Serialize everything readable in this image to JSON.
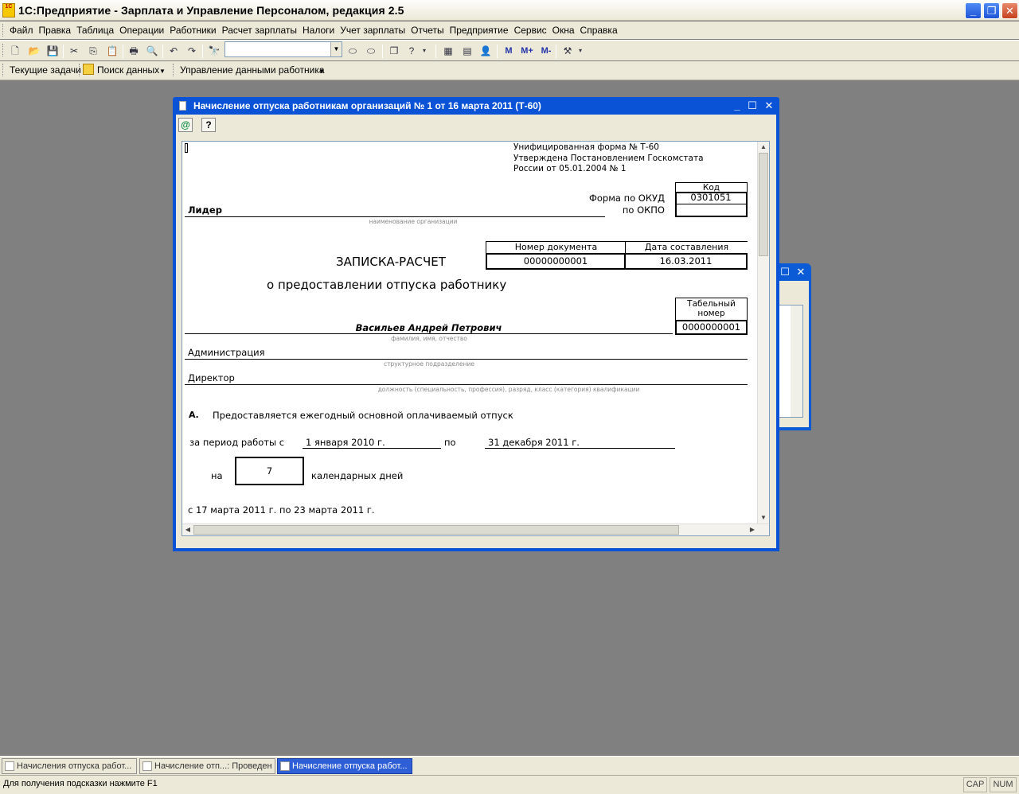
{
  "app": {
    "title": "1С:Предприятие - Зарплата и Управление Персоналом, редакция 2.5",
    "logo_text": "1С"
  },
  "menu": [
    "Файл",
    "Правка",
    "Таблица",
    "Операции",
    "Работники",
    "Расчет зарплаты",
    "Налоги",
    "Учет зарплаты",
    "Отчеты",
    "Предприятие",
    "Сервис",
    "Окна",
    "Справка"
  ],
  "toolbar": {
    "search_value": "",
    "m_labels": [
      "M",
      "M+",
      "M-"
    ]
  },
  "toolbar2": {
    "current_tasks": "Текущие задачи",
    "data_search": "Поиск данных",
    "employee_data": "Управление данными работника"
  },
  "doc_window": {
    "title": "Начисление отпуска работникам организаций № 1 от 16 марта 2011 (Т-60)"
  },
  "form": {
    "header_line1": "Унифицированная форма № Т-60",
    "header_line2": "Утверждена Постановлением Госкомстата",
    "header_line3": "России от 05.01.2004 № 1",
    "code_label": "Код",
    "okud_label": "Форма по ОКУД",
    "okud_value": "0301051",
    "okpo_label": "по ОКПО",
    "okpo_value": "",
    "org_name": "Лидер",
    "org_caption": "наименование организации",
    "doc_number_label": "Номер документа",
    "doc_date_label": "Дата составления",
    "doc_number": "00000000001",
    "doc_date": "16.03.2011",
    "title": "ЗАПИСКА-РАСЧЕТ",
    "subtitle": "о предоставлении отпуска работнику",
    "tab_number_label": "Табельный номер",
    "tab_number": "0000000001",
    "employee_name": "Васильев Андрей Петрович",
    "employee_caption": "фамилия, имя, отчество",
    "department": "Администрация",
    "department_caption": "структурное подразделение",
    "position": "Директор",
    "position_caption": "должность (специальность, профессия), разряд, класс (категория) квалификации",
    "section_letter": "А.",
    "section_text": "Предоставляется ежегодный основной оплачиваемый отпуск",
    "period_label": "за период работы с",
    "period_from": "1 января 2010 г.",
    "period_to_label": "по",
    "period_to": "31 декабря 2011 г.",
    "days_label_pre": "на",
    "days_value": "7",
    "days_label_post": "календарных дней",
    "dates_range": "с 17 марта 2011 г.   по 23 марта 2011 г."
  },
  "taskbar": [
    {
      "label": "Начисления отпуска работ...",
      "active": false
    },
    {
      "label": "Начисление отп...: Проведен",
      "active": false
    },
    {
      "label": "Начисление отпуска работ...",
      "active": true
    }
  ],
  "status": {
    "hint": "Для получения подсказки нажмите F1",
    "cap": "CAP",
    "num": "NUM"
  }
}
